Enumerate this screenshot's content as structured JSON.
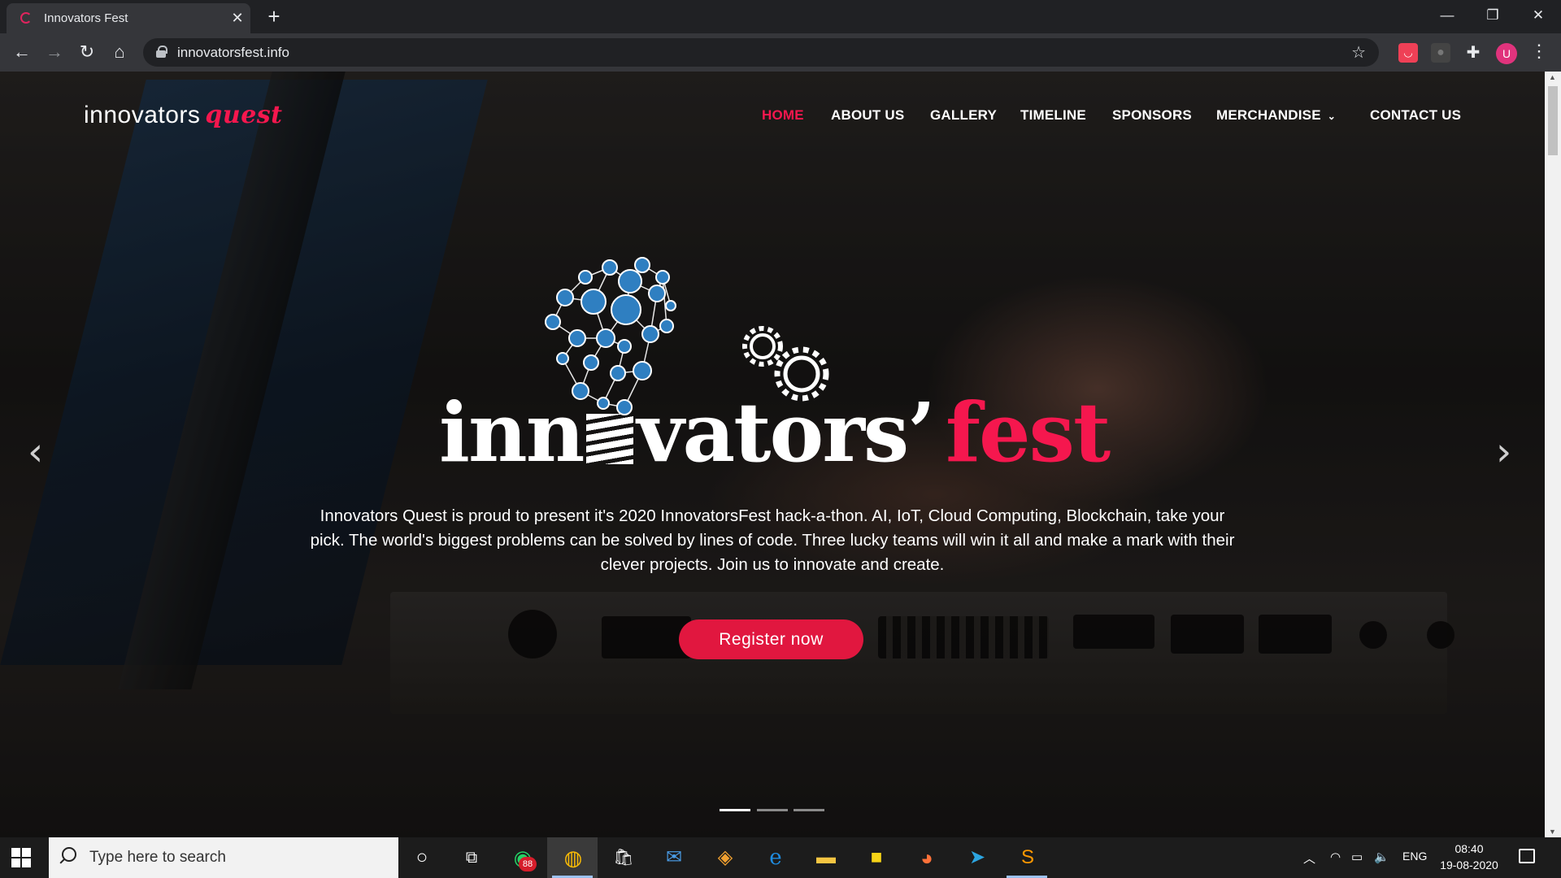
{
  "browser": {
    "tab_title": "Innovators Fest",
    "tab_close": "✕",
    "new_tab": "+",
    "url": "innovatorsfest.info",
    "avatar_letter": "U",
    "window_controls": {
      "minimize": "—",
      "maximize": "❐",
      "close": "✕"
    },
    "icons": {
      "back": "←",
      "forward": "→",
      "reload": "↻",
      "home": "⌂",
      "star": "☆",
      "menu": "⋮",
      "puzzle": "✚"
    }
  },
  "site": {
    "brand": {
      "primary": "innovators",
      "accent": "quest"
    },
    "nav": [
      {
        "label": "HOME",
        "active": true
      },
      {
        "label": "ABOUT US"
      },
      {
        "label": "GALLERY"
      },
      {
        "label": "TIMELINE"
      },
      {
        "label": "SPONSORS"
      },
      {
        "label": "MERCHANDISE"
      },
      {
        "label": "CONTACT US"
      }
    ],
    "merch_chevron": "⌄",
    "hero": {
      "title_part1": "inn",
      "title_part2": "vators’",
      "title_accent": "fest",
      "description": "Innovators Quest is proud to present it's 2020 InnovatorsFest hack-a-thon. AI, IoT, Cloud Computing, Blockchain, take your pick. The world's biggest problems can be solved by lines of code. Three lucky teams will win it all and make a mark with their clever projects. Join us to innovate and create.",
      "cta": "Register now",
      "prev_arrow": "‹",
      "next_arrow": "›",
      "slides": 3,
      "active_slide": 1
    },
    "colors": {
      "accent": "#f5174e",
      "button": "#e1173f"
    }
  },
  "taskbar": {
    "search_placeholder": "Type here to search",
    "whatsapp_badge": "88",
    "language": "ENG",
    "time": "08:40",
    "date": "19-08-2020"
  }
}
